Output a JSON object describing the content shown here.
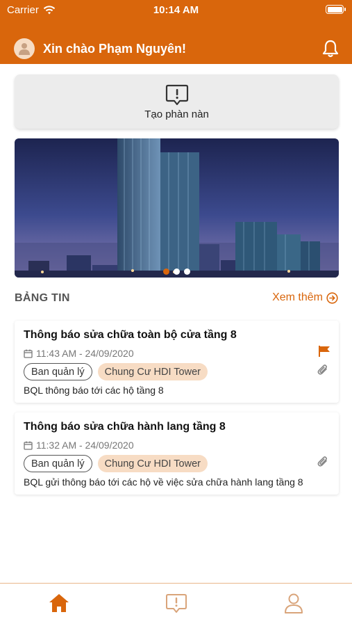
{
  "status_bar": {
    "carrier": "Carrier",
    "time": "10:14 AM"
  },
  "header": {
    "greeting": "Xin chào Phạm Nguyên!"
  },
  "complaint": {
    "label": "Tạo phàn nàn"
  },
  "banner": {
    "slide_count": 3,
    "active_slide": 1
  },
  "news": {
    "section_title": "BẢNG TIN",
    "more_label": "Xem thêm",
    "items": [
      {
        "title": "Thông báo sửa chữa toàn bộ cửa tầng 8",
        "time": "11:43 AM - 24/09/2020",
        "tag_sender": "Ban quản lý",
        "tag_building": "Chung Cư HDI Tower",
        "description": "BQL thông báo tới các hộ tầng 8",
        "flagged": true,
        "has_attachment": true
      },
      {
        "title": "Thông báo sửa chữa hành lang tầng 8",
        "time": "11:32 AM - 24/09/2020",
        "tag_sender": "Ban quản lý",
        "tag_building": "Chung Cư HDI Tower",
        "description": "BQL gửi thông báo tới các hộ về việc sửa chữa hành lang tầng 8",
        "flagged": false,
        "has_attachment": true
      }
    ]
  },
  "tabbar": {
    "icons": [
      "home-icon",
      "complaint-icon",
      "profile-icon"
    ],
    "active": "home-icon"
  },
  "colors": {
    "accent": "#d9660c",
    "tag_fill": "#f7dcc4",
    "complaint_bg": "#ececec"
  }
}
